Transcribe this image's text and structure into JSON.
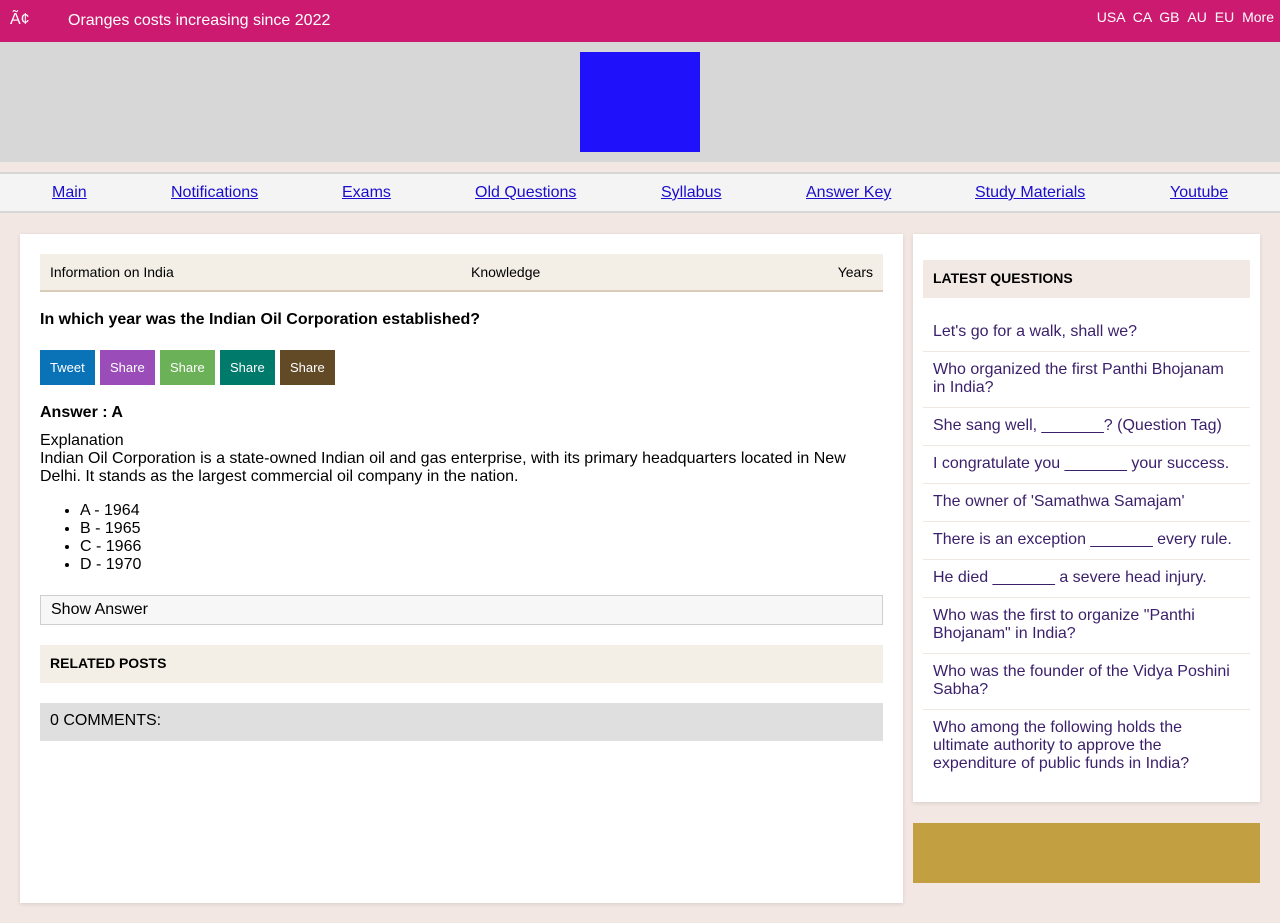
{
  "topbar": {
    "glyph": "Ã¢",
    "ticker": "Oranges costs increasing since 2022",
    "regions": [
      "USA",
      "CA",
      "GB",
      "AU",
      "EU",
      "More"
    ]
  },
  "colors": {
    "topbar": "#cc1a70",
    "logo": "#1f12fb",
    "ad": "#c29f41",
    "link": "#1a0dcc",
    "question_link": "#3a1f6a"
  },
  "nav": {
    "items": [
      "Main",
      "Notifications",
      "Exams",
      "Old Questions",
      "Syllabus",
      "Answer Key",
      "Study Materials",
      "Youtube"
    ]
  },
  "breadcrumb": {
    "left": "Information on India",
    "middle": "Knowledge",
    "right": "Years"
  },
  "question": "In which year was the Indian Oil Corporation established?",
  "share_buttons": [
    {
      "label": "Tweet",
      "color": "#0a73b8"
    },
    {
      "label": "Share",
      "color": "#9a4db8"
    },
    {
      "label": "Share",
      "color": "#6bb157"
    },
    {
      "label": "Share",
      "color": "#007a6a"
    },
    {
      "label": "Share",
      "color": "#634a27"
    }
  ],
  "answer_label": "Answer : A",
  "explanation_title": "Explanation",
  "explanation_text": "Indian Oil Corporation is a state-owned Indian oil and gas enterprise, with its primary headquarters located in New Delhi. It stands as the largest commercial oil company in the nation.",
  "options": [
    "A - 1964",
    "B - 1965",
    "C - 1966",
    "D - 1970"
  ],
  "show_answer": "Show Answer",
  "related_posts": "RELATED POSTS",
  "comments": "0 COMMENTS:",
  "sidebar": {
    "title": "LATEST QUESTIONS",
    "questions": [
      "Let's go for a walk, shall we?",
      "Who organized the first Panthi Bhojanam in India?",
      "She sang well, _______? (Question Tag)",
      "I congratulate you _______ your success.",
      "The owner of 'Samathwa Samajam'",
      "There is an exception _______ every rule.",
      "He died _______ a severe head injury.",
      "Who was the first to organize \"Panthi Bhojanam\" in India?",
      "Who was the founder of the Vidya Poshini Sabha?",
      "Who among the following holds the ultimate authority to approve the expenditure of public funds in India?"
    ]
  }
}
